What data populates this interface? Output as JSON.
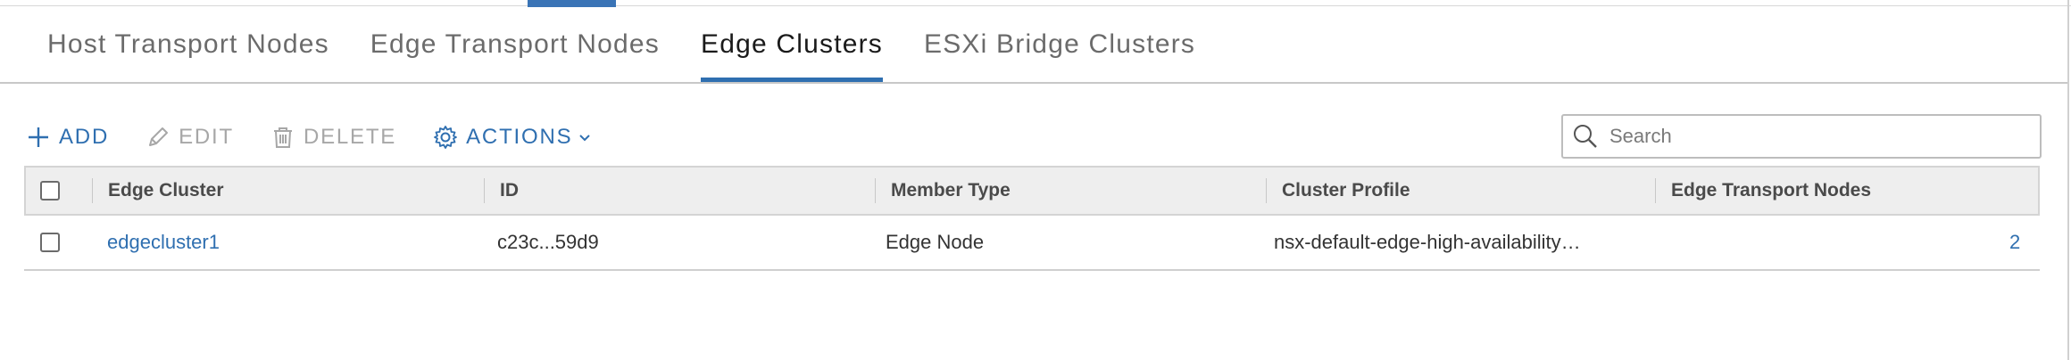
{
  "tabs": [
    {
      "label": "Host Transport Nodes"
    },
    {
      "label": "Edge Transport Nodes"
    },
    {
      "label": "Edge Clusters"
    },
    {
      "label": "ESXi Bridge Clusters"
    }
  ],
  "toolbar": {
    "add_label": "ADD",
    "edit_label": "EDIT",
    "delete_label": "DELETE",
    "actions_label": "ACTIONS"
  },
  "search": {
    "placeholder": "Search"
  },
  "table": {
    "columns": [
      "Edge Cluster",
      "ID",
      "Member Type",
      "Cluster Profile",
      "Edge Transport Nodes"
    ],
    "rows": [
      {
        "edge_cluster": "edgecluster1",
        "id": "c23c...59d9",
        "member_type": "Edge Node",
        "cluster_profile": "nsx-default-edge-high-availability…",
        "edge_transport_nodes": "2"
      }
    ]
  },
  "colors": {
    "accent": "#2f6fb0",
    "disabled": "#a7a7a7",
    "header_bg": "#eeeeee"
  }
}
